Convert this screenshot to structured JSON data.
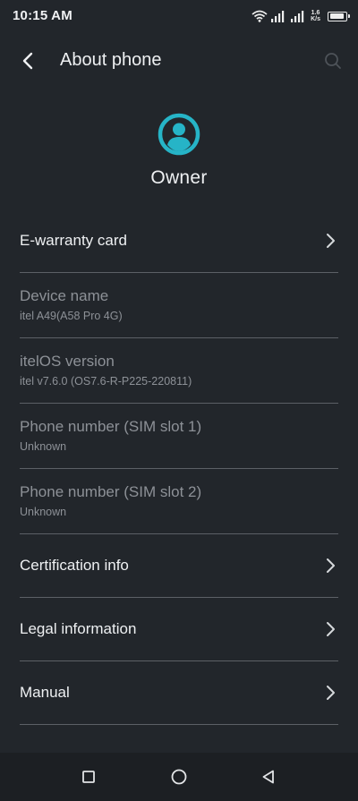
{
  "status_bar": {
    "time": "10:15 AM",
    "speed_value": "1.6",
    "speed_unit": "K/s",
    "icons": [
      "wifi-icon",
      "signal-icon",
      "signal-icon",
      "battery-icon"
    ],
    "battery_level": 0.9
  },
  "toolbar": {
    "title": "About phone",
    "back_icon": "chevron-left-icon",
    "search_icon": "search-icon"
  },
  "owner": {
    "name": "Owner",
    "icon": "account-circle-icon",
    "accent": "#26b4c7"
  },
  "items": [
    {
      "label": "E-warranty card",
      "type": "nav"
    },
    {
      "label": "Device name",
      "sub": "itel A49(A58 Pro 4G)",
      "type": "info"
    },
    {
      "label": "itelOS version",
      "sub": "itel v7.6.0 (OS7.6-R-P225-220811)",
      "type": "info"
    },
    {
      "label": "Phone number (SIM slot 1)",
      "sub": "Unknown",
      "type": "info"
    },
    {
      "label": "Phone number (SIM slot 2)",
      "sub": "Unknown",
      "type": "info"
    },
    {
      "label": "Certification info",
      "type": "nav"
    },
    {
      "label": "Legal information",
      "type": "nav"
    },
    {
      "label": "Manual",
      "type": "nav"
    }
  ],
  "navbar": {
    "icons": [
      "recents-square-icon",
      "home-circle-icon",
      "back-triangle-icon"
    ]
  }
}
